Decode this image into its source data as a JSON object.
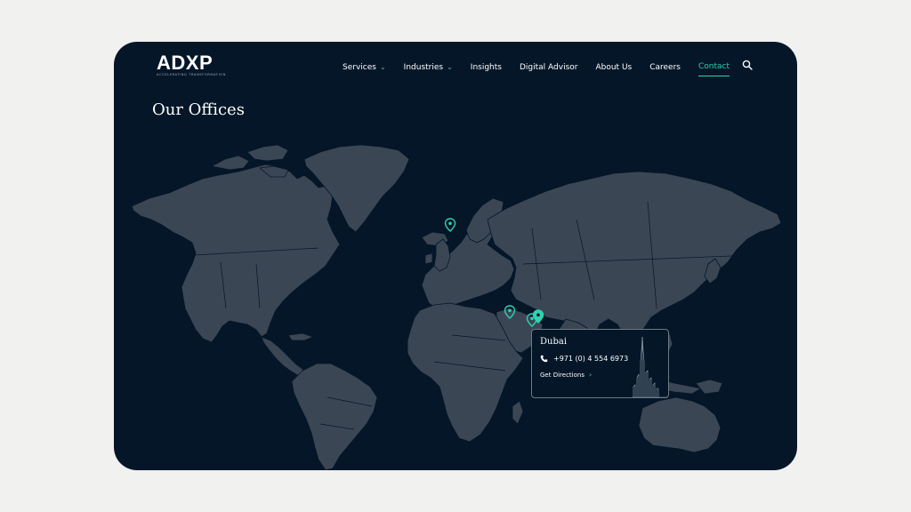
{
  "brand": {
    "logo": "ADXP",
    "tagline": "ACCELERATING TRANSFORMATION"
  },
  "nav": {
    "items": [
      {
        "label": "Services",
        "has_dropdown": true
      },
      {
        "label": "Industries",
        "has_dropdown": true
      },
      {
        "label": "Insights",
        "has_dropdown": false
      },
      {
        "label": "Digital Advisor",
        "has_dropdown": false
      },
      {
        "label": "About Us",
        "has_dropdown": false
      },
      {
        "label": "Careers",
        "has_dropdown": false
      },
      {
        "label": "Contact",
        "has_dropdown": false,
        "active": true
      }
    ],
    "dropdown_glyph": "⌄",
    "search_icon": "search-icon"
  },
  "page": {
    "title": "Our Offices"
  },
  "offices": {
    "locations": [
      "UK",
      "Saudi Arabia",
      "Dubai"
    ],
    "selected": {
      "city": "Dubai",
      "phone": "+971 (0) 4 554 6973",
      "directions_label": "Get Directions",
      "directions_glyph": "›"
    }
  },
  "colors": {
    "background": "#041628",
    "land": "#3b4654",
    "accent": "#2fd2b0",
    "page": "#f1f1f0"
  }
}
